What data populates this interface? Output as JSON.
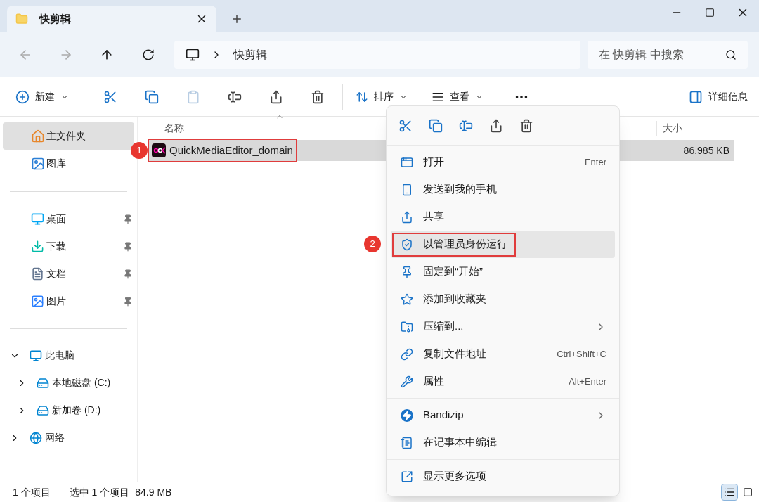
{
  "tab": {
    "title": "快剪辑",
    "selected": true
  },
  "nav": {
    "breadcrumb": "快剪辑",
    "search": {
      "placeholder": "在 快剪辑 中搜索"
    }
  },
  "toolbar": {
    "new_label": "新建",
    "icon_buttons": [
      {
        "disabled": false
      },
      {
        "disabled": false
      },
      {
        "disabled": true
      },
      {
        "disabled": false
      },
      {
        "disabled": false
      },
      {
        "disabled": false
      }
    ],
    "sort_label": "排序",
    "view_label": "查看",
    "details_label": "详细信息"
  },
  "sidebar": {
    "top": [
      {
        "label": "主文件夹",
        "selected": true
      },
      {
        "label": "图库",
        "selected": false
      }
    ],
    "quick": [
      {
        "label": "桌面",
        "pinned": true
      },
      {
        "label": "下载",
        "pinned": true
      },
      {
        "label": "文档",
        "pinned": true
      },
      {
        "label": "图片",
        "pinned": true
      }
    ],
    "tree": [
      {
        "label": "此电脑",
        "expanded": true,
        "children": [
          {
            "label": "本地磁盘 (C:)",
            "expanded": false
          },
          {
            "label": "新加卷 (D:)",
            "expanded": false
          }
        ]
      },
      {
        "label": "网络",
        "expanded": false
      }
    ]
  },
  "table": {
    "columns": [
      "名称",
      "大小"
    ],
    "rows": [
      {
        "name": "QuickMediaEditor_domain",
        "size": "86,985 KB",
        "selected": true,
        "marker": "1"
      }
    ]
  },
  "context_menu": {
    "groups": [
      [
        {
          "label": "打开",
          "shortcut": "Enter",
          "submenu": false,
          "selected": false
        },
        {
          "label": "发送到我的手机",
          "submenu": false,
          "selected": false
        },
        {
          "label": "共享",
          "submenu": false,
          "selected": false
        },
        {
          "label": "以管理员身份运行",
          "submenu": false,
          "selected": true,
          "marker": "2"
        },
        {
          "label": "固定到“开始”",
          "submenu": false,
          "selected": false
        },
        {
          "label": "添加到收藏夹",
          "submenu": false,
          "selected": false
        },
        {
          "label": "压缩到...",
          "submenu": true,
          "selected": false
        },
        {
          "label": "复制文件地址",
          "shortcut": "Ctrl+Shift+C",
          "submenu": false,
          "selected": false
        },
        {
          "label": "属性",
          "shortcut": "Alt+Enter",
          "submenu": false,
          "selected": false
        }
      ],
      [
        {
          "label": "Bandizip",
          "submenu": true,
          "selected": false
        },
        {
          "label": "在记事本中编辑",
          "submenu": false,
          "selected": false
        }
      ],
      [
        {
          "label": "显示更多选项",
          "submenu": false,
          "selected": false
        }
      ]
    ]
  },
  "status_bar": {
    "count": "1 个项目",
    "selection": "选中 1 个项目",
    "size": "84.9 MB",
    "view_buttons": [
      {
        "selected": true
      },
      {
        "selected": false
      }
    ]
  }
}
